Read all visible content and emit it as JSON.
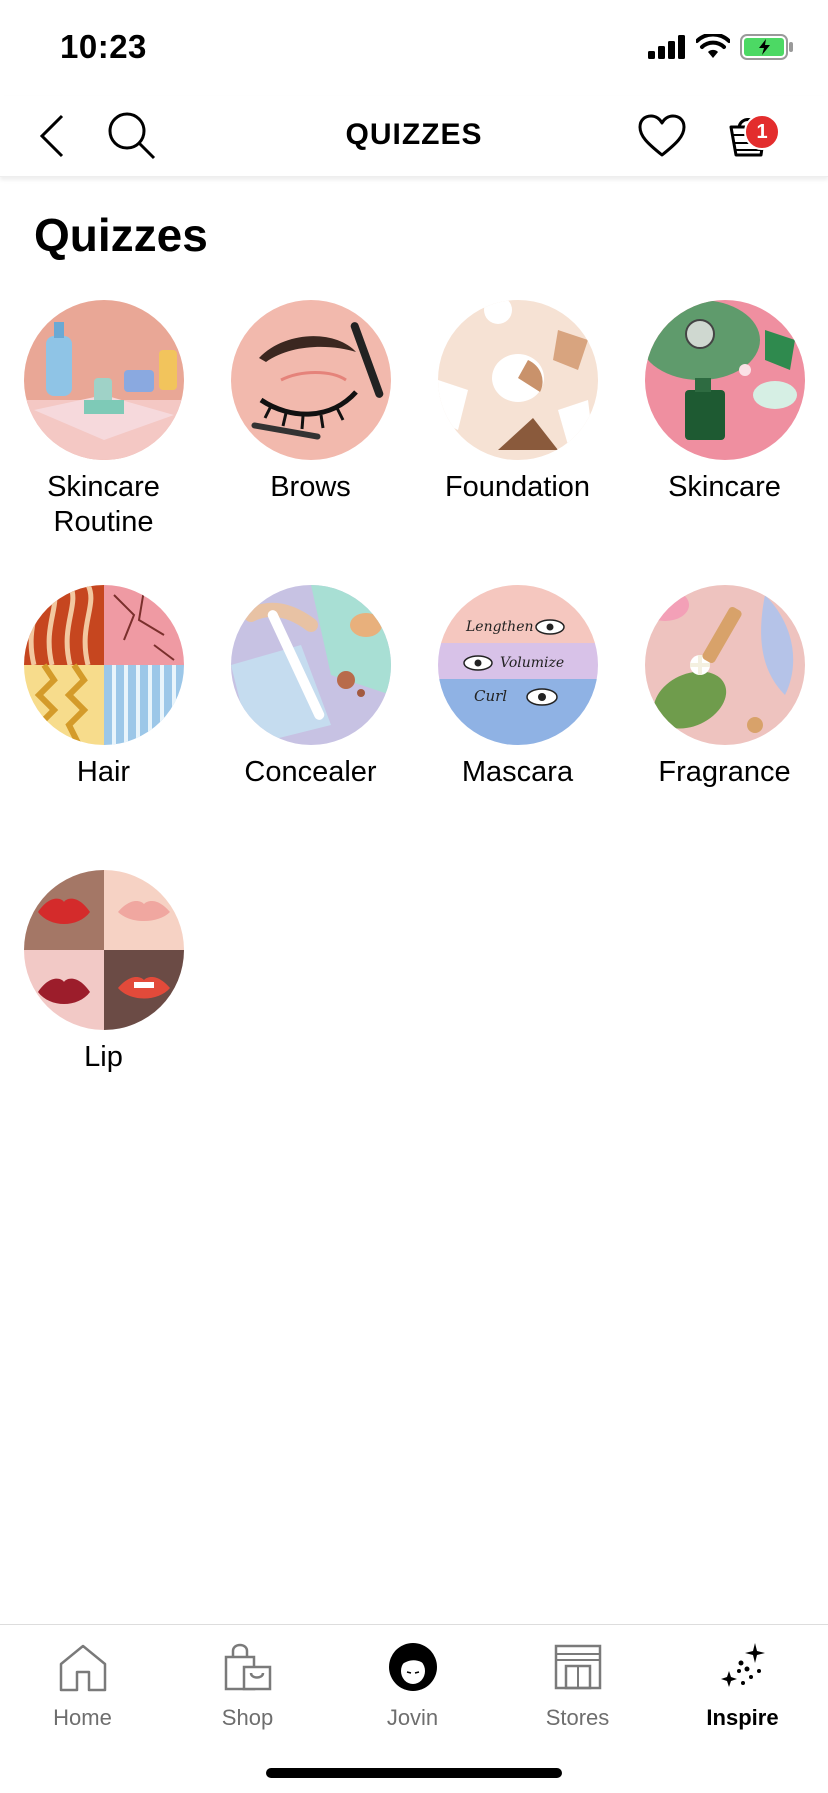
{
  "status_bar": {
    "time": "10:23"
  },
  "nav": {
    "title": "QUIZZES",
    "cart_count": "1"
  },
  "page": {
    "heading": "Quizzes"
  },
  "quizzes": [
    {
      "label": "Skincare\nRoutine",
      "icon": "skincare-routine-illustration"
    },
    {
      "label": "Brows",
      "icon": "brows-illustration"
    },
    {
      "label": "Foundation",
      "icon": "foundation-illustration"
    },
    {
      "label": "Skincare",
      "icon": "skincare-illustration"
    },
    {
      "label": "Hair",
      "icon": "hair-illustration"
    },
    {
      "label": "Concealer",
      "icon": "concealer-illustration"
    },
    {
      "label": "Mascara",
      "icon": "mascara-illustration",
      "image_text": [
        "Lengthen",
        "Volumize",
        "Curl"
      ]
    },
    {
      "label": "Fragrance",
      "icon": "fragrance-illustration"
    },
    {
      "label": "Lip",
      "icon": "lip-illustration"
    }
  ],
  "tabs": [
    {
      "label": "Home",
      "icon": "home-icon"
    },
    {
      "label": "Shop",
      "icon": "shopping-bag-icon"
    },
    {
      "label": "Jovin",
      "icon": "avatar-icon"
    },
    {
      "label": "Stores",
      "icon": "store-icon"
    },
    {
      "label": "Inspire",
      "icon": "sparkle-icon",
      "active": true
    }
  ],
  "colors": {
    "badge": "#e32d2d",
    "battery": "#4cd964",
    "accent": "#000000"
  }
}
